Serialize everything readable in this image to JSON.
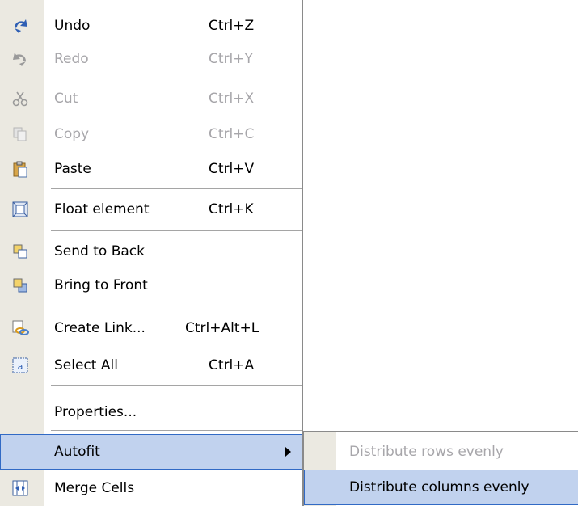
{
  "menu": {
    "undo": {
      "label": "Undo",
      "shortcut": "Ctrl+Z"
    },
    "redo": {
      "label": "Redo",
      "shortcut": "Ctrl+Y"
    },
    "cut": {
      "label": "Cut",
      "shortcut": "Ctrl+X"
    },
    "copy": {
      "label": "Copy",
      "shortcut": "Ctrl+C"
    },
    "paste": {
      "label": "Paste",
      "shortcut": "Ctrl+V"
    },
    "float": {
      "label": "Float element",
      "shortcut": "Ctrl+K"
    },
    "send_back": {
      "label": "Send to Back"
    },
    "bring_front": {
      "label": "Bring to Front"
    },
    "create_link": {
      "label": "Create Link...",
      "shortcut": "Ctrl+Alt+L"
    },
    "select_all": {
      "label": "Select All",
      "shortcut": "Ctrl+A"
    },
    "properties": {
      "label": "Properties..."
    },
    "autofit": {
      "label": "Autofit"
    },
    "merge": {
      "label": "Merge Cells"
    }
  },
  "submenu": {
    "distribute_rows": {
      "label": "Distribute rows evenly"
    },
    "distribute_columns": {
      "label": "Distribute columns evenly"
    }
  },
  "colors": {
    "highlight": "#c1d2ee",
    "highlight_border": "#316ac5",
    "gutter": "#ebe9e1",
    "disabled_text": "#a7a6aa"
  }
}
